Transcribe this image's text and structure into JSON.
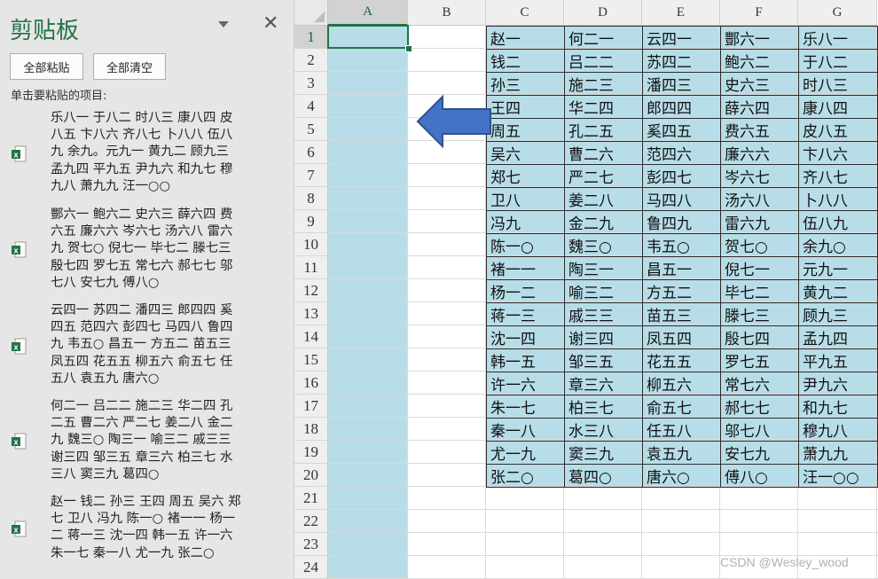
{
  "pane": {
    "title": "剪贴板",
    "close_label": "✕",
    "paste_all": "全部粘贴",
    "clear_all": "全部清空",
    "hint": "单击要粘贴的项目:",
    "items": [
      {
        "text": "乐八一 于八二 时八三 康八四 皮\n八五 卞八六 齐八七 卜八八 伍八\n九 余九。元九一 黄九二 顾九三\n孟九四 平九五 尹九六 和九七 穆\n九八 萧九九 汪一○○"
      },
      {
        "text": "酆六一 鲍六二 史六三 薛六四 费\n六五 廉六六 岑六七 汤六八 雷六\n九 贺七○ 倪七一 毕七二 滕七三\n殷七四 罗七五 常七六 郝七七 邬\n七八 安七九 傅八○"
      },
      {
        "text": "云四一 苏四二 潘四三 郎四四 奚\n四五 范四六 彭四七 马四八 鲁四\n九 韦五○ 昌五一 方五二 苗五三\n凤五四 花五五 柳五六 俞五七 任\n五八 袁五九 唐六○"
      },
      {
        "text": "何二一 吕二二 施二三 华二四 孔\n二五 曹二六 严二七 姜二八 金二\n九 魏三○ 陶三一 喻三二 戚三三\n谢三四 邹三五 章三六 柏三七 水\n三八 窦三九 葛四○"
      },
      {
        "text": "赵一 钱二 孙三 王四 周五 吴六 郑\n七 卫八 冯九 陈一○ 褚一一 杨一\n二 蒋一三 沈一四 韩一五 许一六\n朱一七 秦一八 尤一九 张二○"
      }
    ]
  },
  "sheet": {
    "columns": [
      "A",
      "B",
      "C",
      "D",
      "E",
      "F",
      "G"
    ],
    "rows": [
      "1",
      "2",
      "3",
      "4",
      "5",
      "6",
      "7",
      "8",
      "9",
      "10",
      "11",
      "12",
      "13",
      "14",
      "15",
      "16",
      "17",
      "18",
      "19",
      "20",
      "21",
      "22",
      "23",
      "24"
    ],
    "selected_cell": "A1",
    "table": [
      [
        "赵一",
        "何二一",
        "云四一",
        "酆六一",
        "乐八一"
      ],
      [
        "钱二",
        "吕二二",
        "苏四二",
        "鲍六二",
        "于八二"
      ],
      [
        "孙三",
        "施二三",
        "潘四三",
        "史六三",
        "时八三"
      ],
      [
        "王四",
        "华二四",
        "郎四四",
        "薛六四",
        "康八四"
      ],
      [
        "周五",
        "孔二五",
        "奚四五",
        "费六五",
        "皮八五"
      ],
      [
        "吴六",
        "曹二六",
        "范四六",
        "廉六六",
        "卞八六"
      ],
      [
        "郑七",
        "严二七",
        "彭四七",
        "岑六七",
        "齐八七"
      ],
      [
        "卫八",
        "姜二八",
        "马四八",
        "汤六八",
        "卜八八"
      ],
      [
        "冯九",
        "金二九",
        "鲁四九",
        "雷六九",
        "伍八九"
      ],
      [
        "陈一○",
        "魏三○",
        "韦五○",
        "贺七○",
        "余九○"
      ],
      [
        "褚一一",
        "陶三一",
        "昌五一",
        "倪七一",
        "元九一"
      ],
      [
        "杨一二",
        "喻三二",
        "方五二",
        "毕七二",
        "黄九二"
      ],
      [
        "蒋一三",
        "戚三三",
        "苗五三",
        "滕七三",
        "顾九三"
      ],
      [
        "沈一四",
        "谢三四",
        "凤五四",
        "殷七四",
        "孟九四"
      ],
      [
        "韩一五",
        "邹三五",
        "花五五",
        "罗七五",
        "平九五"
      ],
      [
        "许一六",
        "章三六",
        "柳五六",
        "常七六",
        "尹九六"
      ],
      [
        "朱一七",
        "柏三七",
        "俞五七",
        "郝七七",
        "和九七"
      ],
      [
        "秦一八",
        "水三八",
        "任五八",
        "邬七八",
        "穆九八"
      ],
      [
        "尤一九",
        "窦三九",
        "袁五九",
        "安七九",
        "萧九九"
      ],
      [
        "张二○",
        "葛四○",
        "唐六○",
        "傅八○",
        "汪一○○"
      ]
    ]
  },
  "colors": {
    "accent": "#217346",
    "cell_fill": "#b7dde8",
    "arrow": "#4472c4"
  },
  "icons": {
    "clip_item": "excel-file-icon",
    "arrow": "left-arrow-icon"
  },
  "watermark": "CSDN @Wesley_wood"
}
